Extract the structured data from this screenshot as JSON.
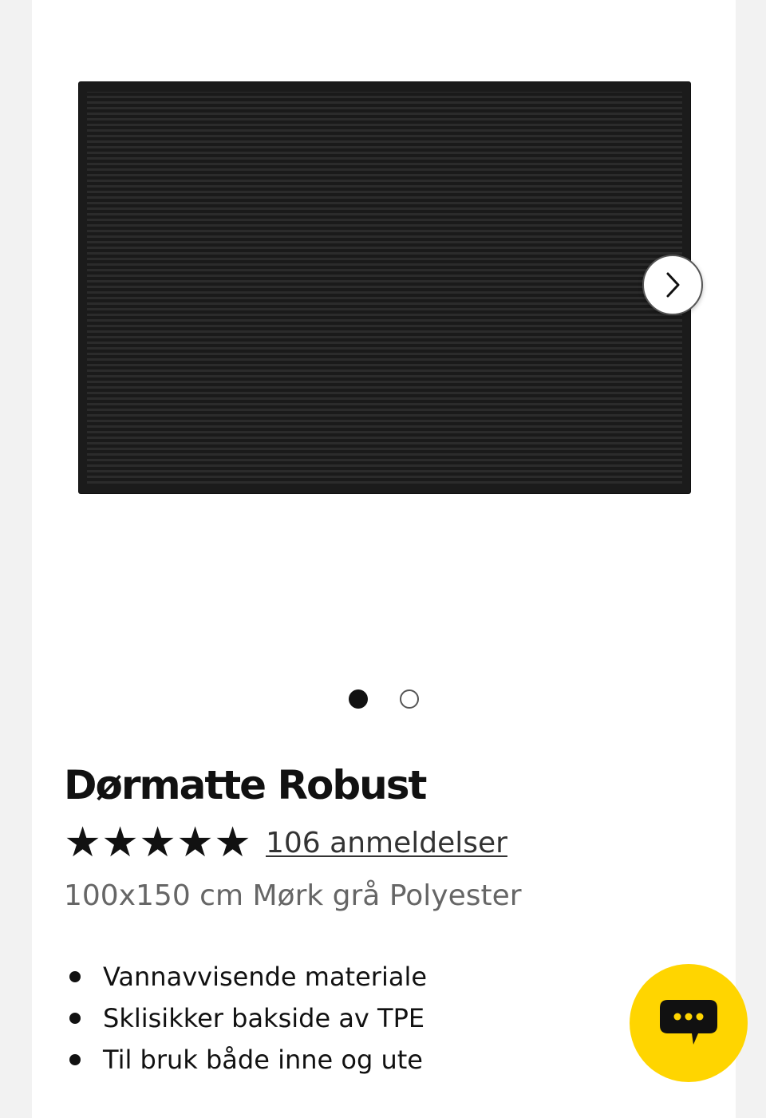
{
  "gallery": {
    "image_alt": "Dørmatte Robust",
    "current_slide": 1,
    "total_slides": 2,
    "next_icon": "chevron-right-icon"
  },
  "product": {
    "title": "Dørmatte Robust",
    "rating": 5,
    "rating_max": 5,
    "reviews_label": "106 anmeldelser",
    "variant": "100x150 cm Mørk grå Polyester",
    "features": [
      "Vannavvisende materiale",
      "Sklisikker bakside av TPE",
      "Til bruk både inne og ute"
    ]
  },
  "chat": {
    "icon": "chat-bubble-icon",
    "color": "#ffd500"
  },
  "colors": {
    "page_background": "#f2f2f2",
    "text": "#111111",
    "muted_text": "#666666"
  }
}
